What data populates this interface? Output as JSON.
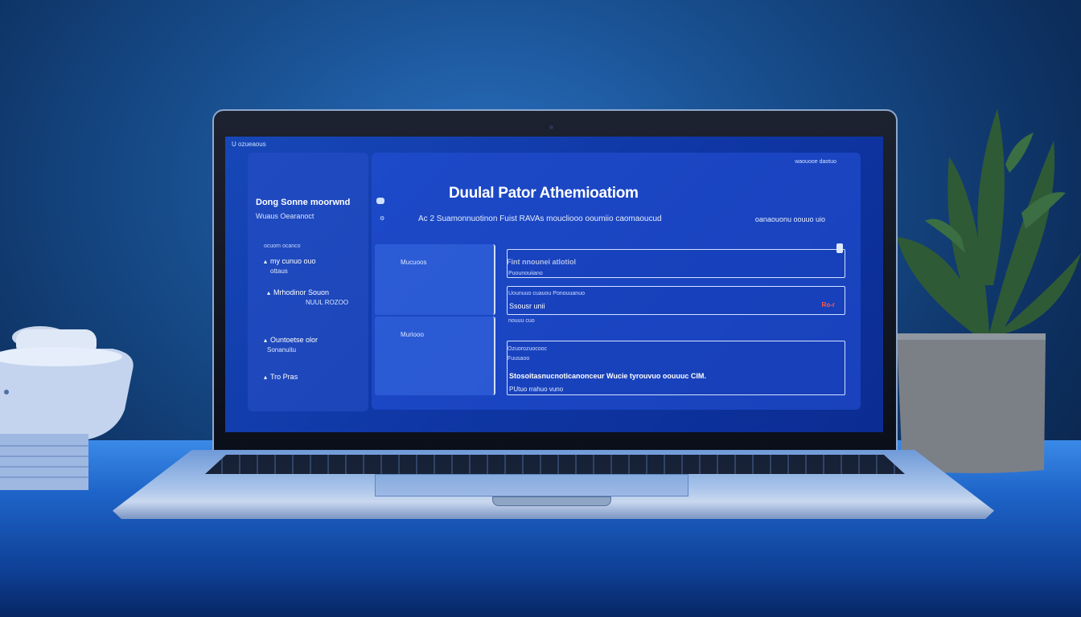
{
  "window": {
    "system_label": "U ozueaous"
  },
  "sidebar": {
    "title": "Dong Sonne moorwnd",
    "subtitle": "Wuaus Oearanoct",
    "mini_label": "ocuom ocanco",
    "items": [
      {
        "line1": "my cunuo ouo",
        "line2": "ottaus"
      },
      {
        "line1": "Mrhodinor Souon",
        "line2": "NUUL   ROZOO"
      },
      {
        "line1": "Ountoetse olor",
        "line2": "Sonanuitu"
      },
      {
        "line1": "Tro Pras",
        "line2": ""
      }
    ]
  },
  "main": {
    "title": "Duulal Pator Athemioatiom",
    "top_right": "waouooe daotuo",
    "subtitle_left": "Ac 2  Suamonnuotinon Fuist RAVAs moucliooo ooumiio caomaoucud",
    "subtitle_right": "oanaouonu oouuo uio",
    "col1_label": "Mucuoos",
    "col2_label": "Muriooo",
    "fields": [
      {
        "label": "Fint nnounei atlotiol",
        "hint": "Puounouiiano",
        "value": "",
        "error": ""
      },
      {
        "label": "Uounuuo cuauou Ponouuanuo",
        "hint": "nouuu cuo",
        "value": "Ssousr unii",
        "error": "Ro-r"
      }
    ],
    "big_field": {
      "hint1": "Ozuorozuocooc",
      "hint2": "Fuusaoo",
      "line1": "Stosoitasnucnoticanonceur  Wucie tyrouvuo oouuuc CIM.",
      "line2": "PUtuo rrahuo vuno"
    }
  },
  "colors": {
    "screen": "#1245b0",
    "accent_error": "#ff5a4a"
  }
}
